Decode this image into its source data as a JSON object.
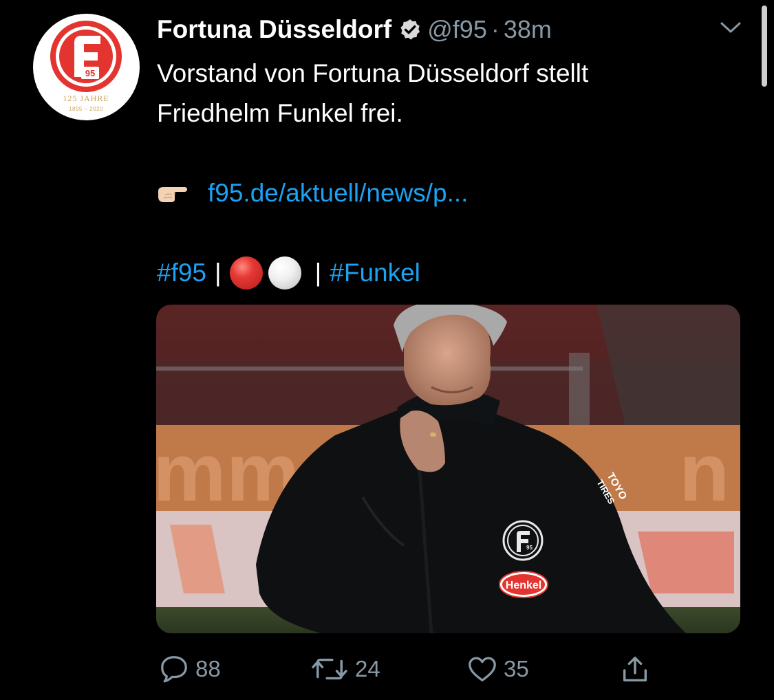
{
  "tweet": {
    "display_name": "Fortuna Düsseldorf",
    "handle": "@f95",
    "separator": "·",
    "time": "38m",
    "line1": "Vorstand von Fortuna Düsseldorf stellt",
    "line2": "Friedhelm Funkel frei.",
    "pointer_emoji": "👉🏻",
    "link_text": "f95.de/aktuell/news/p...",
    "hashtag1": "#f95",
    "pipe1": "|",
    "pipe2": "|",
    "hashtag2": "#Funkel",
    "emoji_circles": [
      "red-circle",
      "white-circle"
    ]
  },
  "avatar": {
    "badge_number": "95",
    "anniversary": "125 JAHRE",
    "years": "1895 – 2020",
    "brand_red": "#e3342f",
    "gold": "#c9a45c"
  },
  "photo": {
    "jacket_text_1": "TOYO",
    "jacket_text_2": "TIRES",
    "crest_number": "95",
    "sponsor": "Henkel"
  },
  "actions": {
    "replies": "88",
    "retweets": "24",
    "likes": "35"
  },
  "colors": {
    "background": "#000000",
    "link": "#1da1f2",
    "muted": "#8899a6"
  }
}
